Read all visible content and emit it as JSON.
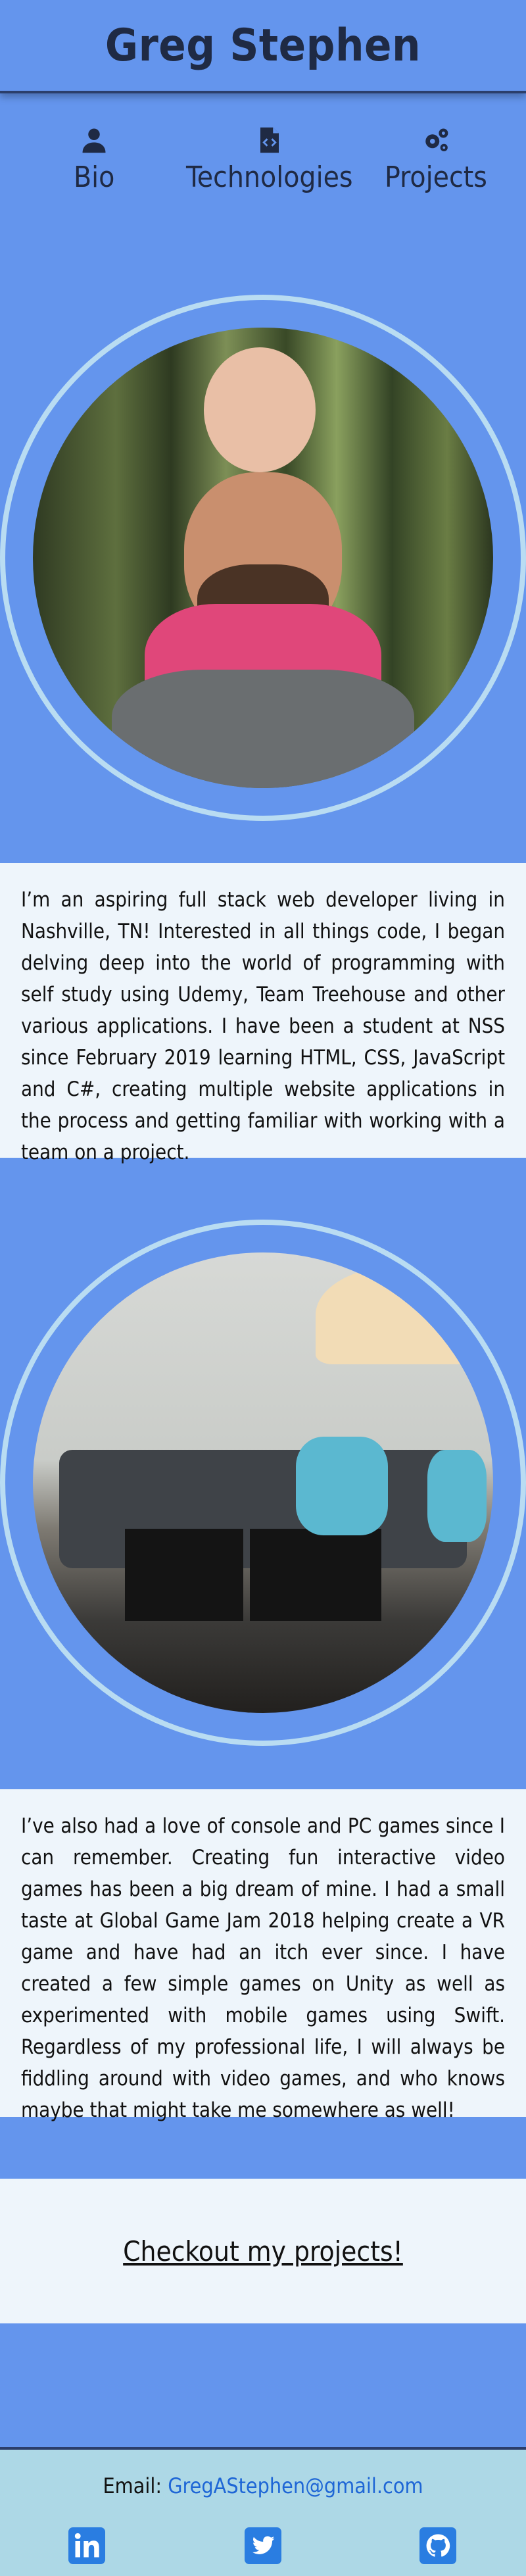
{
  "header": {
    "title": "Greg Stephen"
  },
  "nav": {
    "items": [
      {
        "label": "Bio",
        "icon": "user-icon"
      },
      {
        "label": "Technologies",
        "icon": "code-file-icon"
      },
      {
        "label": "Projects",
        "icon": "cogs-icon"
      }
    ]
  },
  "bio": {
    "paragraph1": "I’m an aspiring full stack web developer living in Nashville, TN! Interested in all things code, I began delving deep into the world of programming with self study using Udemy, Team Treehouse and other various applications. I have been a student at NSS since February 2019 learning HTML, CSS, JavaScript and C#, creating multiple website applications in the process and getting familiar with working with a team on a project.",
    "paragraph2": "I’ve also had a love of console and PC games since I can remember. Creating fun interactive video games has been a big dream of mine. I had a small taste at Global Game Jam 2018 helping create a VR game and have had an itch ever since. I have created a few simple games on Unity as well as experimented with mobile games using Swift. Regardless of my professional life, I will always be fiddling around with video games, and who knows maybe that might take me somewhere as well!"
  },
  "cta": {
    "label": "Checkout my projects!"
  },
  "footer": {
    "email_label": "Email: ",
    "email": "GregAStephen@gmail.com",
    "social": [
      "linkedin-icon",
      "twitter-icon",
      "github-icon"
    ]
  },
  "colors": {
    "background": "#6495ED",
    "panel": "#EEF5FB",
    "footer": "#ADD8E6",
    "ring": "#B9DCF2",
    "link": "#1E66D6",
    "social_icon": "#2A7DE1"
  }
}
